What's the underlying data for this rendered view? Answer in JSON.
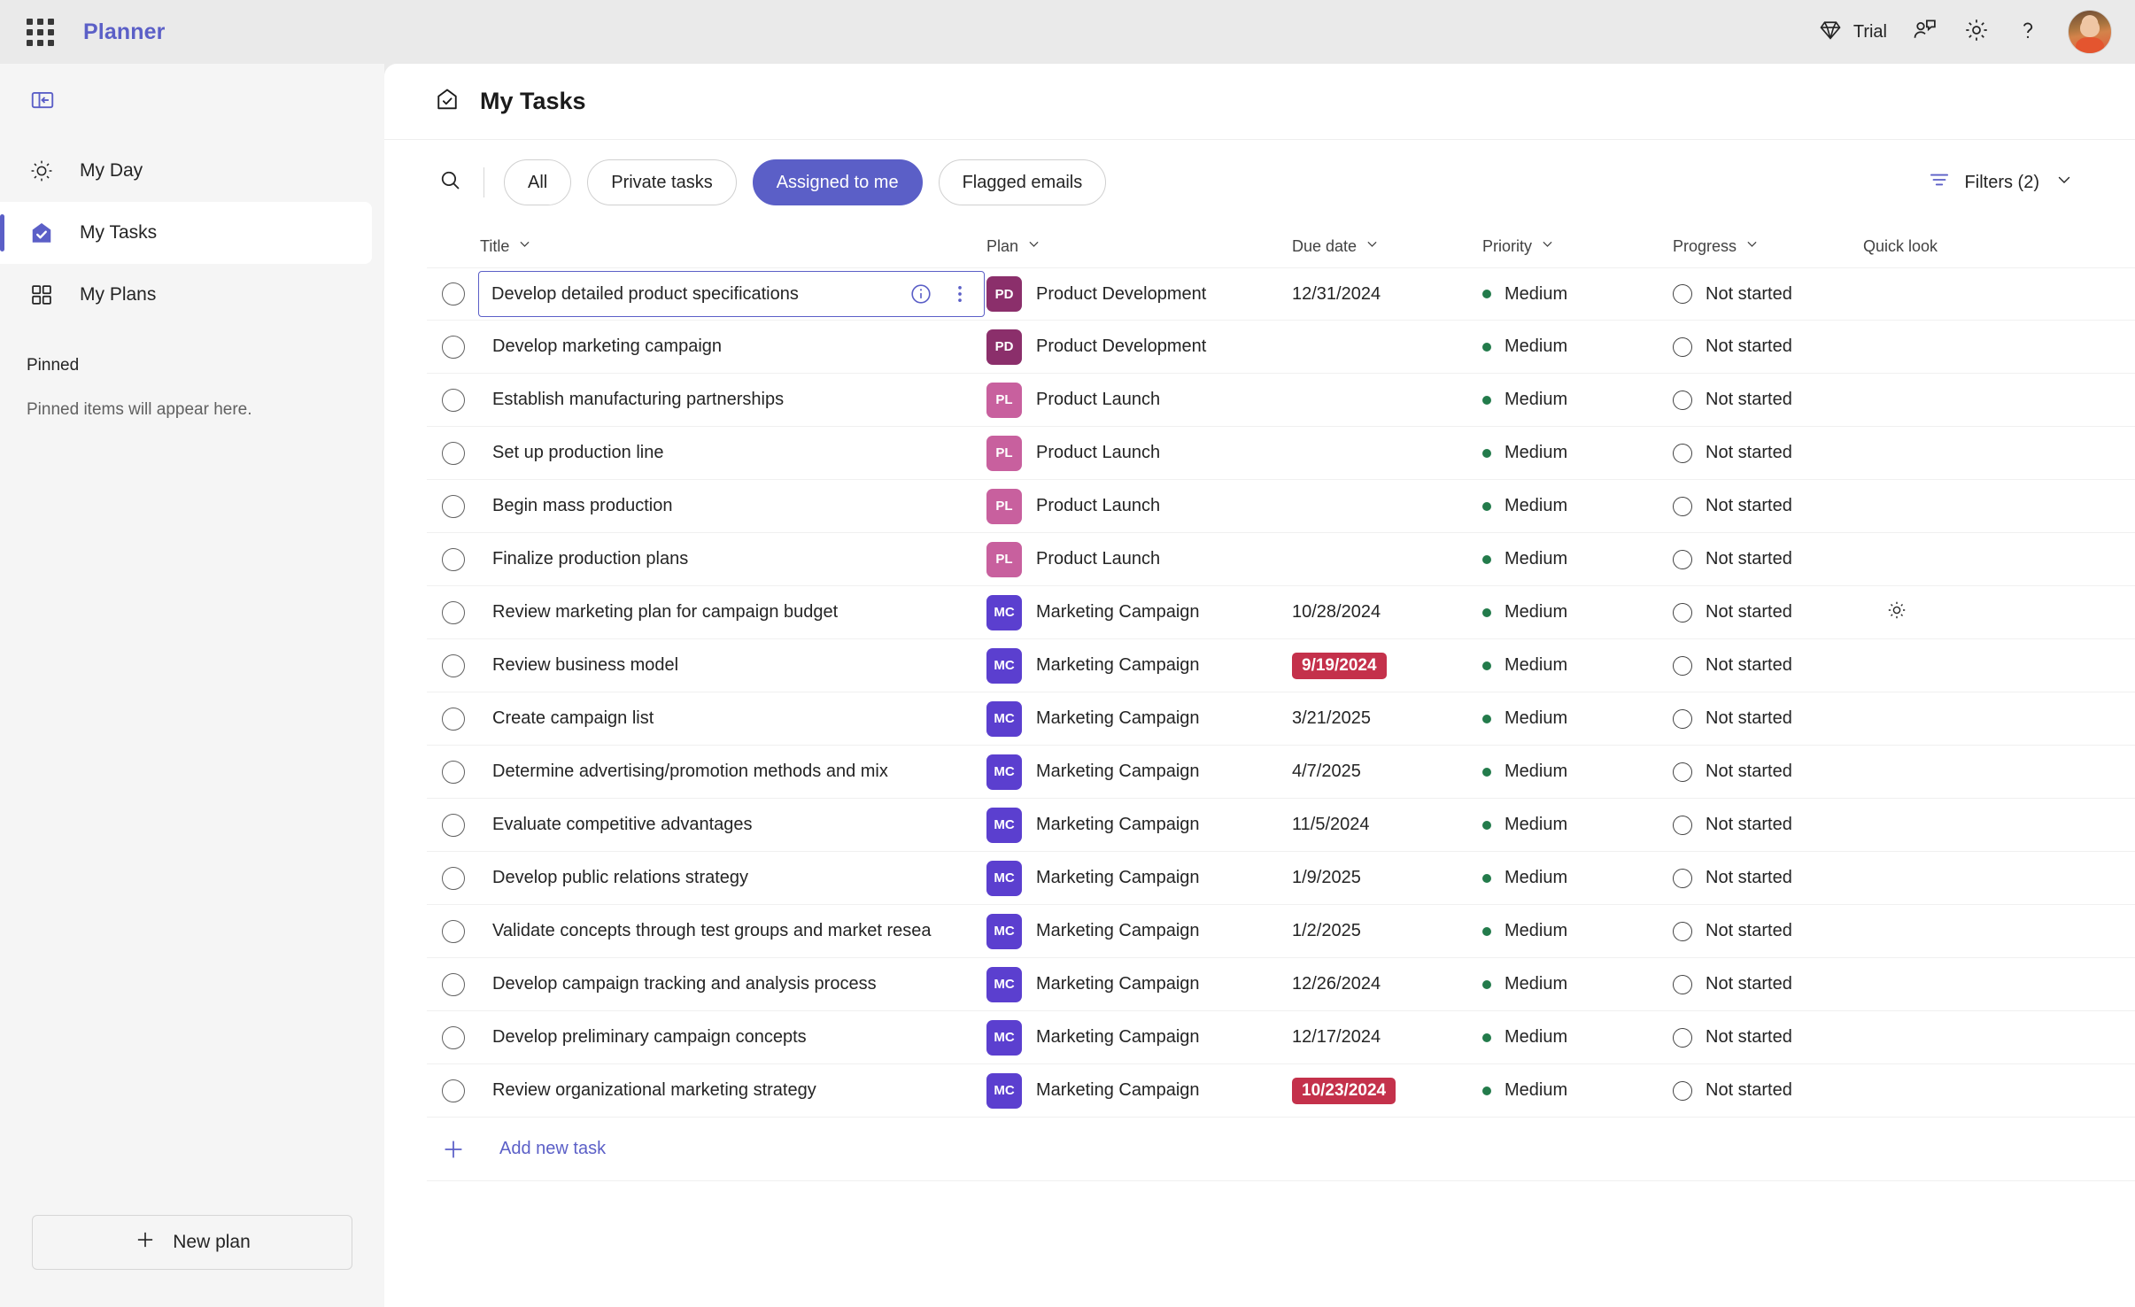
{
  "topbar": {
    "app_launcher_icon": "waffle-grid-icon",
    "app_title": "Planner",
    "trial_label": "Trial",
    "trial_icon": "diamond-icon",
    "feedback_icon": "person-chat-icon",
    "settings_icon": "gear-icon",
    "help_icon": "question-mark-icon",
    "avatar_icon": "user-avatar"
  },
  "sidebar": {
    "collapse_icon": "collapse-panel-icon",
    "items": [
      {
        "label": "My Day",
        "icon": "sun-icon",
        "active": false
      },
      {
        "label": "My Tasks",
        "icon": "tasks-home-icon",
        "active": true
      },
      {
        "label": "My Plans",
        "icon": "grid-icon",
        "active": false
      }
    ],
    "pinned_header": "Pinned",
    "pinned_empty": "Pinned items will appear here.",
    "new_plan_label": "New plan",
    "new_plan_icon": "plus-icon"
  },
  "page": {
    "title": "My Tasks",
    "title_icon": "tasks-home-icon"
  },
  "toolbar": {
    "search_icon": "search-icon",
    "pills": [
      {
        "label": "All",
        "active": false
      },
      {
        "label": "Private tasks",
        "active": false
      },
      {
        "label": "Assigned to me",
        "active": true
      },
      {
        "label": "Flagged emails",
        "active": false
      }
    ],
    "filters_label": "Filters (2)",
    "filters_icon": "filter-icon",
    "filters_chevron_icon": "chevron-down-icon"
  },
  "table": {
    "columns": [
      {
        "label": "Title",
        "sortable": true
      },
      {
        "label": "Plan",
        "sortable": true
      },
      {
        "label": "Due date",
        "sortable": true
      },
      {
        "label": "Priority",
        "sortable": true
      },
      {
        "label": "Progress",
        "sortable": true
      },
      {
        "label": "Quick look",
        "sortable": false
      }
    ],
    "add_task_label": "Add new task",
    "rows": [
      {
        "title": "Develop detailed product specifications",
        "plan": "Product Development",
        "plan_initials": "PD",
        "plan_color": "#8b2f6b",
        "due": "12/31/2024",
        "overdue": false,
        "priority": "Medium",
        "progress": "Not started",
        "quicklook": "",
        "selected": true
      },
      {
        "title": "Develop marketing campaign",
        "plan": "Product Development",
        "plan_initials": "PD",
        "plan_color": "#8b2f6b",
        "due": "",
        "overdue": false,
        "priority": "Medium",
        "progress": "Not started",
        "quicklook": "",
        "selected": false
      },
      {
        "title": "Establish manufacturing partnerships",
        "plan": "Product Launch",
        "plan_initials": "PL",
        "plan_color": "#c8609e",
        "due": "",
        "overdue": false,
        "priority": "Medium",
        "progress": "Not started",
        "quicklook": "",
        "selected": false
      },
      {
        "title": "Set up production line",
        "plan": "Product Launch",
        "plan_initials": "PL",
        "plan_color": "#c8609e",
        "due": "",
        "overdue": false,
        "priority": "Medium",
        "progress": "Not started",
        "quicklook": "",
        "selected": false
      },
      {
        "title": "Begin mass production",
        "plan": "Product Launch",
        "plan_initials": "PL",
        "plan_color": "#c8609e",
        "due": "",
        "overdue": false,
        "priority": "Medium",
        "progress": "Not started",
        "quicklook": "",
        "selected": false
      },
      {
        "title": "Finalize production plans",
        "plan": "Product Launch",
        "plan_initials": "PL",
        "plan_color": "#c8609e",
        "due": "",
        "overdue": false,
        "priority": "Medium",
        "progress": "Not started",
        "quicklook": "",
        "selected": false
      },
      {
        "title": "Review marketing plan for campaign budget",
        "plan": "Marketing Campaign",
        "plan_initials": "MC",
        "plan_color": "#5b3fcf",
        "due": "10/28/2024",
        "overdue": false,
        "priority": "Medium",
        "progress": "Not started",
        "quicklook": "sun-icon",
        "selected": false
      },
      {
        "title": "Review business model",
        "plan": "Marketing Campaign",
        "plan_initials": "MC",
        "plan_color": "#5b3fcf",
        "due": "9/19/2024",
        "overdue": true,
        "priority": "Medium",
        "progress": "Not started",
        "quicklook": "",
        "selected": false
      },
      {
        "title": "Create campaign list",
        "plan": "Marketing Campaign",
        "plan_initials": "MC",
        "plan_color": "#5b3fcf",
        "due": "3/21/2025",
        "overdue": false,
        "priority": "Medium",
        "progress": "Not started",
        "quicklook": "",
        "selected": false
      },
      {
        "title": "Determine advertising/promotion methods and mix",
        "plan": "Marketing Campaign",
        "plan_initials": "MC",
        "plan_color": "#5b3fcf",
        "due": "4/7/2025",
        "overdue": false,
        "priority": "Medium",
        "progress": "Not started",
        "quicklook": "",
        "selected": false
      },
      {
        "title": "Evaluate competitive advantages",
        "plan": "Marketing Campaign",
        "plan_initials": "MC",
        "plan_color": "#5b3fcf",
        "due": "11/5/2024",
        "overdue": false,
        "priority": "Medium",
        "progress": "Not started",
        "quicklook": "",
        "selected": false
      },
      {
        "title": "Develop public relations strategy",
        "plan": "Marketing Campaign",
        "plan_initials": "MC",
        "plan_color": "#5b3fcf",
        "due": "1/9/2025",
        "overdue": false,
        "priority": "Medium",
        "progress": "Not started",
        "quicklook": "",
        "selected": false
      },
      {
        "title": "Validate concepts through test groups and market resea",
        "plan": "Marketing Campaign",
        "plan_initials": "MC",
        "plan_color": "#5b3fcf",
        "due": "1/2/2025",
        "overdue": false,
        "priority": "Medium",
        "progress": "Not started",
        "quicklook": "",
        "selected": false
      },
      {
        "title": "Develop campaign tracking and analysis process",
        "plan": "Marketing Campaign",
        "plan_initials": "MC",
        "plan_color": "#5b3fcf",
        "due": "12/26/2024",
        "overdue": false,
        "priority": "Medium",
        "progress": "Not started",
        "quicklook": "",
        "selected": false
      },
      {
        "title": "Develop preliminary campaign concepts",
        "plan": "Marketing Campaign",
        "plan_initials": "MC",
        "plan_color": "#5b3fcf",
        "due": "12/17/2024",
        "overdue": false,
        "priority": "Medium",
        "progress": "Not started",
        "quicklook": "",
        "selected": false
      },
      {
        "title": "Review organizational marketing strategy",
        "plan": "Marketing Campaign",
        "plan_initials": "MC",
        "plan_color": "#5b3fcf",
        "due": "10/23/2024",
        "overdue": true,
        "priority": "Medium",
        "progress": "Not started",
        "quicklook": "",
        "selected": false
      }
    ]
  },
  "colors": {
    "brand_purple": "#5b5fc7",
    "overdue_red": "#c4314b",
    "priority_green": "#237b4b"
  }
}
